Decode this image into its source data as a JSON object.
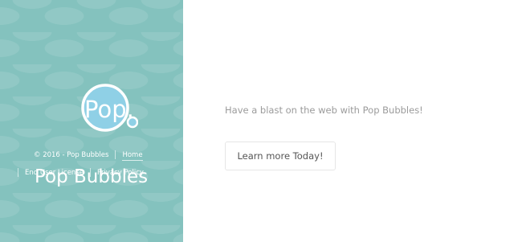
{
  "colors": {
    "panel": "#84c2be",
    "logo_bubble": "#8fd0e6",
    "tagline": "#9b9b9b",
    "button_text": "#555555",
    "button_border": "#e6e6e6"
  },
  "sidebar": {
    "logo_text": "Pop.",
    "copyright": "© 2016 - Pop Bubbles",
    "links": {
      "home": "Home",
      "eula": "End User License",
      "privacy": "Privacy Policy"
    },
    "brand_name": "Pop Bubbles"
  },
  "main": {
    "tagline": "Have a blast on the web with Pop Bubbles!",
    "cta_label": "Learn more Today!"
  }
}
